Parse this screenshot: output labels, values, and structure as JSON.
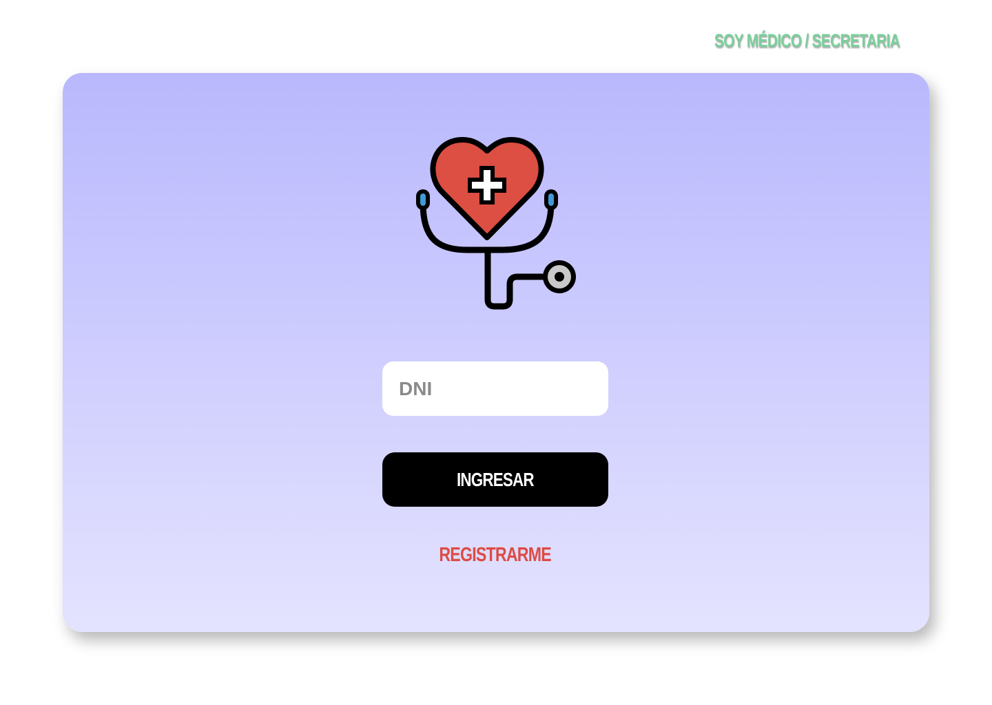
{
  "header": {
    "role_link": "SOY MÉDICO / SECRETARIA"
  },
  "login": {
    "logo_icon": "heart-stethoscope-icon",
    "dni_placeholder": "DNI",
    "dni_value": "",
    "submit_label": "INGRESAR",
    "register_label": "REGISTRARME"
  },
  "colors": {
    "role_link": "#7ccf9c",
    "card_top": "#b9b8fd",
    "card_bottom": "#e4e3ff",
    "button_bg": "#000000",
    "button_text": "#ffffff",
    "register_link": "#dd4b45",
    "heart": "#dd4e43"
  }
}
